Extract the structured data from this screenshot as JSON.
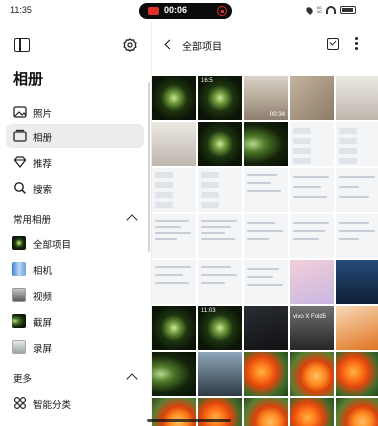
{
  "status_bar": {
    "time": "11:35",
    "recording_time": "00:06",
    "network_labels": [
      "5G",
      "4G"
    ]
  },
  "sidebar": {
    "title": "相册",
    "nav": [
      {
        "label": "照片",
        "icon": "image-icon"
      },
      {
        "label": "相册",
        "icon": "album-icon",
        "active": true
      },
      {
        "label": "推荐",
        "icon": "diamond-icon"
      },
      {
        "label": "搜索",
        "icon": "search-icon"
      }
    ],
    "common_albums_header": "常用相册",
    "common_albums": [
      {
        "label": "全部项目"
      },
      {
        "label": "相机"
      },
      {
        "label": "视频"
      },
      {
        "label": "截屏"
      },
      {
        "label": "录屏"
      }
    ],
    "more_header": "更多",
    "more_items": [
      {
        "label": "智能分类",
        "icon": "smart-category-icon"
      }
    ]
  },
  "main": {
    "title": "全部项目",
    "thumb_text": {
      "t1": "16:5",
      "t2": "00:34",
      "t3": "11:03",
      "t4": "vivo X Fold5"
    }
  },
  "colors": {
    "accent_red": "#e0302a",
    "active_item_bg": "#ececec",
    "text": "#111111"
  }
}
